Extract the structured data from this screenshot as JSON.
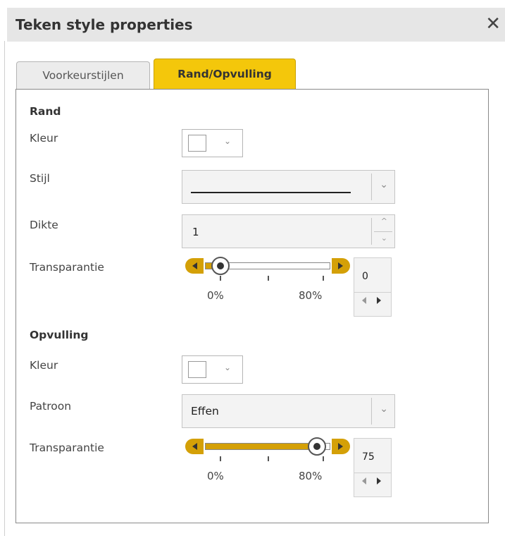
{
  "dialog": {
    "title": "Teken style properties",
    "close_icon": "close-icon"
  },
  "tabs": [
    {
      "label": "Voorkeurstijlen",
      "active": false
    },
    {
      "label": "Rand/Opvulling",
      "active": true
    }
  ],
  "rand": {
    "title": "Rand",
    "kleur_label": "Kleur",
    "kleur_value": "#ffffff",
    "stijl_label": "Stijl",
    "dikte_label": "Dikte",
    "dikte_value": "1",
    "transparantie_label": "Transparantie",
    "transparantie_value": "0",
    "transparantie_percent": 0,
    "tick_min": "0%",
    "tick_max": "80%"
  },
  "opvulling": {
    "title": "Opvulling",
    "kleur_label": "Kleur",
    "kleur_value": "#ffffff",
    "patroon_label": "Patroon",
    "patroon_value": "Effen",
    "transparantie_label": "Transparantie",
    "transparantie_value": "75",
    "transparantie_percent": 75,
    "tick_min": "0%",
    "tick_max": "80%"
  },
  "colors": {
    "accent": "#f4c70b",
    "slider_gold": "#d4a007"
  }
}
